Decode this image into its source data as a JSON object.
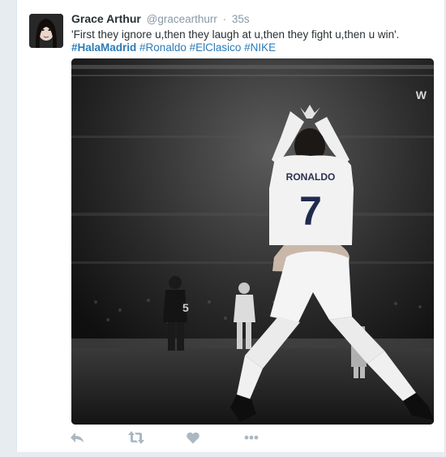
{
  "tweet": {
    "fullname": "Grace Arthur",
    "username": "@gracearthurr",
    "separator": "·",
    "time": "35s",
    "text": "'First they ignore u,then they laugh at u,then they fight u,then u win'.",
    "hashtags": [
      {
        "text": "#HalaMadrid",
        "strong": true
      },
      {
        "text": "#Ronaldo",
        "strong": false
      },
      {
        "text": "#ElClasico",
        "strong": false
      },
      {
        "text": "#NIKE",
        "strong": false
      }
    ]
  },
  "media": {
    "jersey_name": "RONALDO",
    "jersey_number": "7",
    "bg_player_number": "5",
    "corner_letter": "W"
  },
  "actions": [
    {
      "name": "reply-icon"
    },
    {
      "name": "retweet-icon"
    },
    {
      "name": "like-icon"
    },
    {
      "name": "more-icon"
    }
  ],
  "colors": {
    "background": "#e6ecf0",
    "link": "#2b7bb9",
    "secondary_text": "#8899a6",
    "icon": "#aab8c2"
  }
}
